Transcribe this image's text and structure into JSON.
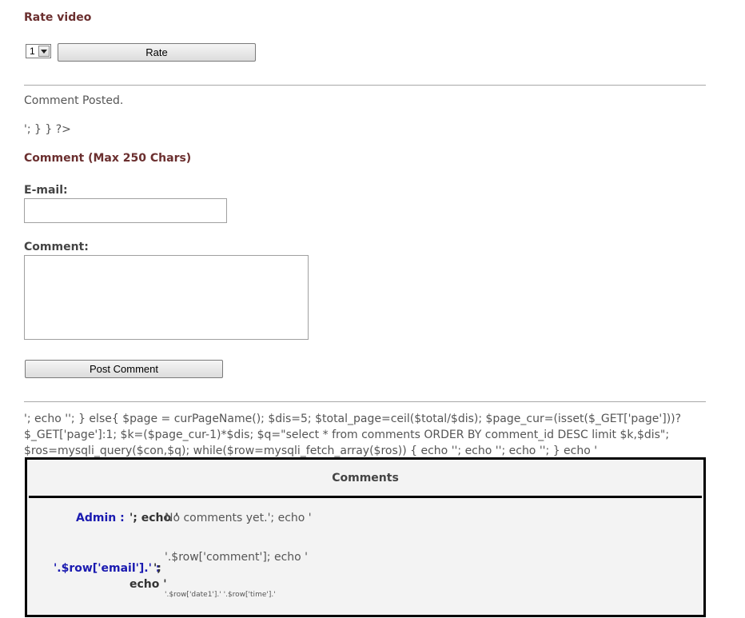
{
  "rate": {
    "heading": "Rate video",
    "select_value": "1",
    "button_label": "Rate"
  },
  "status": {
    "posted": "Comment Posted.",
    "php_fragment_1": "'; } } ?>"
  },
  "form": {
    "heading": "Comment (Max 250 Chars)",
    "email_label": "E-mail:",
    "email_value": "",
    "comment_label": "Comment:",
    "comment_value": "",
    "submit_label": "Post Comment"
  },
  "php_block": {
    "line1": "'; echo ''; } else{ $page = curPageName(); $dis=5; $total_page=ceil($total/$dis); $page_cur=(isset($_GET['page']))?",
    "line2": "$_GET['page']:1; $k=($page_cur-1)*$dis; $q=\"select * from comments ORDER BY comment_id DESC limit $k,$dis\";",
    "line3": "$ros=mysqli_query($con,$q); while($row=mysqli_fetch_array($ros)) { echo ''; echo ''; echo ''; } echo '"
  },
  "comments_table": {
    "header": "Comments",
    "row1": {
      "name": "Admin :",
      "echo_part": "'; echo '",
      "text": "No comments yet.'; echo '"
    },
    "row2": {
      "name_expr": "'.$row['email'].' :",
      "name_suffix": "';",
      "echo_line": "echo '",
      "text": "'.$row['comment']; echo '",
      "date_expr": "'.$row['date1'].' '.$row['time'].'"
    }
  }
}
